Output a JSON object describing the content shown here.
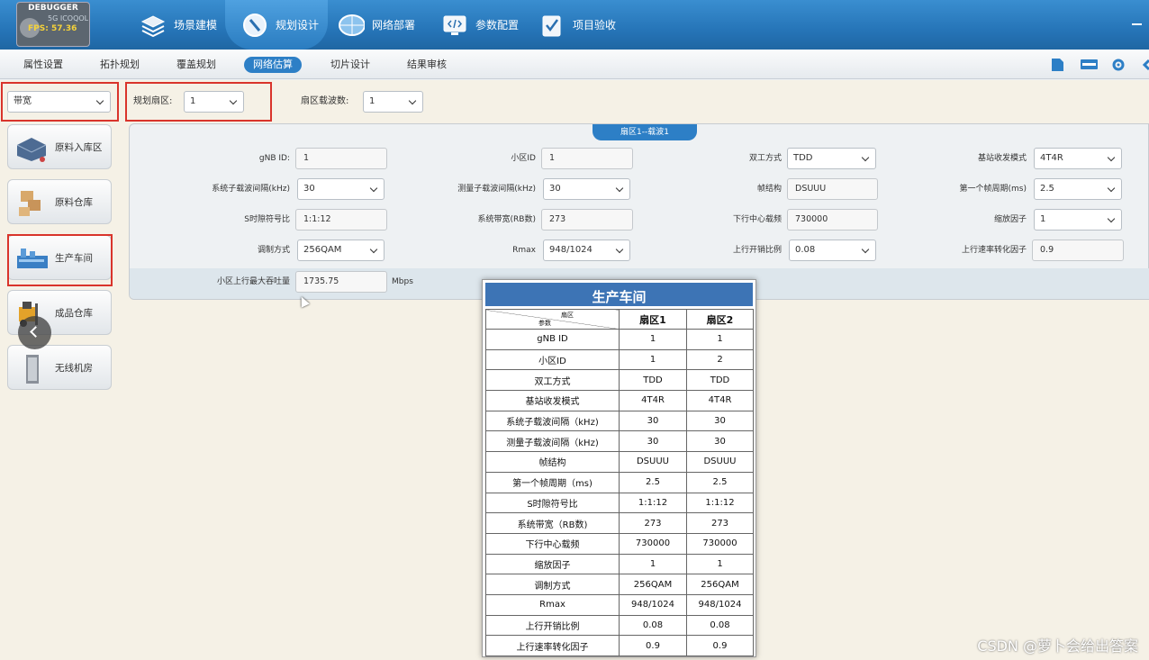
{
  "debugger": {
    "title": "DEBUGGER",
    "fps": "FPS: 57.36",
    "version": "5G ICOQOL"
  },
  "main_tabs": [
    {
      "label": "场景建模",
      "icon": "layers-icon"
    },
    {
      "label": "规划设计",
      "icon": "compass-icon"
    },
    {
      "label": "网络部署",
      "icon": "globe-icon"
    },
    {
      "label": "参数配置",
      "icon": "code-icon"
    },
    {
      "label": "项目验收",
      "icon": "check-icon"
    }
  ],
  "sub_tabs": [
    "属性设置",
    "拓扑规划",
    "覆盖规划",
    "网络估算",
    "切片设计",
    "结果审核"
  ],
  "filters": {
    "bandwidth": "带宽",
    "sector_label": "规划扇区:",
    "sector_value": "1",
    "carrier_label": "扇区载波数:",
    "carrier_value": "1"
  },
  "sidebar": [
    {
      "label": "原料入库区",
      "icon": "truck-icon"
    },
    {
      "label": "原料仓库",
      "icon": "boxes-icon"
    },
    {
      "label": "生产车间",
      "icon": "factory-icon"
    },
    {
      "label": "成品仓库",
      "icon": "forklift-icon"
    },
    {
      "label": "无线机房",
      "icon": "server-icon"
    }
  ],
  "panel": {
    "header": "扇区1--载波1",
    "fields": {
      "gnb_id_label": "gNB ID:",
      "gnb_id": "1",
      "cell_id_label": "小区ID",
      "cell_id": "1",
      "duplex_label": "双工方式",
      "duplex": "TDD",
      "trx_label": "基站收发模式",
      "trx": "4T4R",
      "scs_label": "系统子载波间隔(kHz)",
      "scs": "30",
      "mscs_label": "测量子载波间隔(kHz)",
      "mscs": "30",
      "frame_label": "帧结构",
      "frame": "DSUUU",
      "period_label": "第一个帧周期(ms)",
      "period": "2.5",
      "ssym_label": "S时隙符号比",
      "ssym": "1:1:12",
      "bw_label": "系统带宽(RB数)",
      "bw": "273",
      "dlfreq_label": "下行中心载频",
      "dlfreq": "730000",
      "scale_label": "缩放因子",
      "scale": "1",
      "mod_label": "调制方式",
      "mod": "256QAM",
      "rmax_label": "Rmax",
      "rmax": "948/1024",
      "ulov_label": "上行开销比例",
      "ulov": "0.08",
      "ulconv_label": "上行速率转化因子",
      "ulconv": "0.9",
      "ulmax_label": "小区上行最大吞吐量",
      "ulmax": "1735.75",
      "ulmax_unit": "Mbps"
    }
  },
  "table": {
    "title": "生产车间",
    "corner_top": "扇区",
    "corner_bottom": "参数",
    "columns": [
      "扇区1",
      "扇区2"
    ],
    "rows": [
      [
        "gNB ID",
        "1",
        "1"
      ],
      [
        "小区ID",
        "1",
        "2"
      ],
      [
        "双工方式",
        "TDD",
        "TDD"
      ],
      [
        "基站收发模式",
        "4T4R",
        "4T4R"
      ],
      [
        "系统子载波间隔（kHz)",
        "30",
        "30"
      ],
      [
        "测量子载波间隔（kHz)",
        "30",
        "30"
      ],
      [
        "帧结构",
        "DSUUU",
        "DSUUU"
      ],
      [
        "第一个帧周期（ms)",
        "2.5",
        "2.5"
      ],
      [
        "S时隙符号比",
        "1:1:12",
        "1:1:12"
      ],
      [
        "系统带宽（RB数)",
        "273",
        "273"
      ],
      [
        "下行中心载频",
        "730000",
        "730000"
      ],
      [
        "缩放因子",
        "1",
        "1"
      ],
      [
        "调制方式",
        "256QAM",
        "256QAM"
      ],
      [
        "Rmax",
        "948/1024",
        "948/1024"
      ],
      [
        "上行开销比例",
        "0.08",
        "0.08"
      ],
      [
        "上行速率转化因子",
        "0.9",
        "0.9"
      ]
    ]
  },
  "watermark": "CSDN @萝卜会给出答案",
  "colors": {
    "accent": "#2d7fc6",
    "topbar": "#2675b8",
    "highlight": "#d9342b"
  }
}
